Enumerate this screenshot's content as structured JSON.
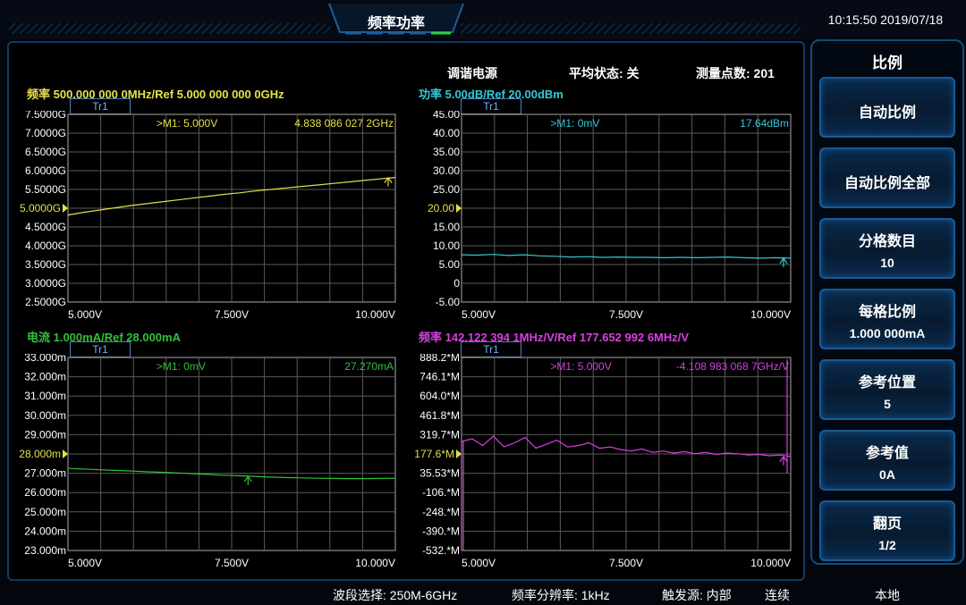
{
  "header": {
    "title": "频率功率",
    "clock": "10:15:50  2019/07/18"
  },
  "info_bar": {
    "source": "调谐电源",
    "avg_state": "平均状态: 关",
    "points": "测量点数: 201"
  },
  "status_bar": {
    "band": "波段选择: 250M-6GHz",
    "resolution": "频率分辨率: 1kHz",
    "trigger": "触发源: 内部",
    "mode": "连续",
    "local": "本地"
  },
  "plots": [
    {
      "title": "频率 500.000 000 0MHz/Ref 5.000 000 000 0GHz",
      "color": "#e6e04a",
      "trace_label": "Tr1",
      "marker_text": ">M1: 5.000V",
      "marker_value": "4.838 086 027 2GHz",
      "y_ticks": [
        "7.5000G",
        "7.0000G",
        "6.5000G",
        "6.0000G",
        "5.5000G",
        "5.0000G",
        "4.5000G",
        "4.0000G",
        "3.5000G",
        "3.0000G",
        "2.5000G"
      ],
      "ref_tick_index": 5,
      "x_ticks": [
        "5.000V",
        "7.500V",
        "10.000V"
      ],
      "trace": [
        4.82,
        4.89,
        4.95,
        5.01,
        5.07,
        5.12,
        5.17,
        5.22,
        5.27,
        5.32,
        5.37,
        5.41,
        5.46,
        5.5,
        5.54,
        5.58,
        5.62,
        5.66,
        5.7,
        5.74,
        5.78,
        5.82
      ],
      "y_min": 2.5,
      "y_max": 7.5
    },
    {
      "title": "功率 5.00dB/Ref 20.00dBm",
      "color": "#33c9d8",
      "trace_label": "Tr1",
      "marker_text": ">M1: 0mV",
      "marker_value": "17.64dBm",
      "y_ticks": [
        "45.00",
        "40.00",
        "35.00",
        "30.00",
        "25.00",
        "20.00",
        "15.00",
        "10.00",
        "5.00",
        "0",
        "-5.00"
      ],
      "ref_tick_index": 5,
      "x_ticks": [
        "5.000V",
        "7.500V",
        "10.000V"
      ],
      "trace": [
        7.6,
        7.5,
        7.7,
        7.4,
        7.6,
        7.3,
        7.2,
        7.0,
        7.1,
        6.9,
        7.0,
        6.9,
        6.9,
        6.8,
        6.9,
        6.8,
        6.9,
        7.0,
        6.8,
        6.7,
        6.8,
        6.7
      ],
      "y_min": -5,
      "y_max": 45
    },
    {
      "title": "电流 1.000mA/Ref 28.000mA",
      "color": "#31c03a",
      "trace_label": "Tr1",
      "marker_text": ">M1: 0mV",
      "marker_value": "27.270mA",
      "y_ticks": [
        "33.000m",
        "32.000m",
        "31.000m",
        "30.000m",
        "29.000m",
        "28.000m",
        "27.000m",
        "26.000m",
        "25.000m",
        "24.000m",
        "23.000m"
      ],
      "ref_tick_index": 5,
      "x_ticks": [
        "5.000V",
        "7.500V",
        "10.000V"
      ],
      "trace": [
        27.25,
        27.22,
        27.18,
        27.15,
        27.12,
        27.08,
        27.05,
        27.02,
        26.98,
        26.94,
        26.9,
        26.87,
        26.84,
        26.8,
        26.78,
        26.76,
        26.74,
        26.73,
        26.72,
        26.72,
        26.73,
        26.74
      ],
      "y_min": 23,
      "y_max": 33
    },
    {
      "title": "频率 142.122 394 1MHz/V/Ref 177.652 992 6MHz/V",
      "color": "#d93fe0",
      "trace_label": "Tr1",
      "marker_text": ">M1: 5.000V",
      "marker_value": "-4.108 983 068 7GHz/V",
      "y_ticks": [
        "888.2*M",
        "746.1*M",
        "604.0*M",
        "461.8*M",
        "319.7*M",
        "177.6*M",
        "35.53*M",
        "-106.*M",
        "-248.*M",
        "-390.*M",
        "-532.*M"
      ],
      "ref_tick_index": 5,
      "x_ticks": [
        "5.000V",
        "7.500V",
        "10.000V"
      ],
      "trace": [
        270,
        290,
        240,
        310,
        230,
        260,
        300,
        220,
        250,
        280,
        230,
        240,
        260,
        220,
        230,
        210,
        200,
        215,
        190,
        200,
        185,
        195,
        180,
        190,
        175,
        185,
        180,
        170,
        175,
        165,
        170,
        160
      ],
      "y_min": -532,
      "y_max": 888.2
    }
  ],
  "softkeys": {
    "title": "比例",
    "keys": [
      {
        "label": "自动比例",
        "value": ""
      },
      {
        "label": "自动比例全部",
        "value": ""
      },
      {
        "label": "分格数目",
        "value": "10"
      },
      {
        "label": "每格比例",
        "value": "1.000 000mA"
      },
      {
        "label": "参考位置",
        "value": "5"
      },
      {
        "label": "参考值",
        "value": "0A"
      },
      {
        "label": "翻页",
        "value": "1/2"
      }
    ]
  }
}
